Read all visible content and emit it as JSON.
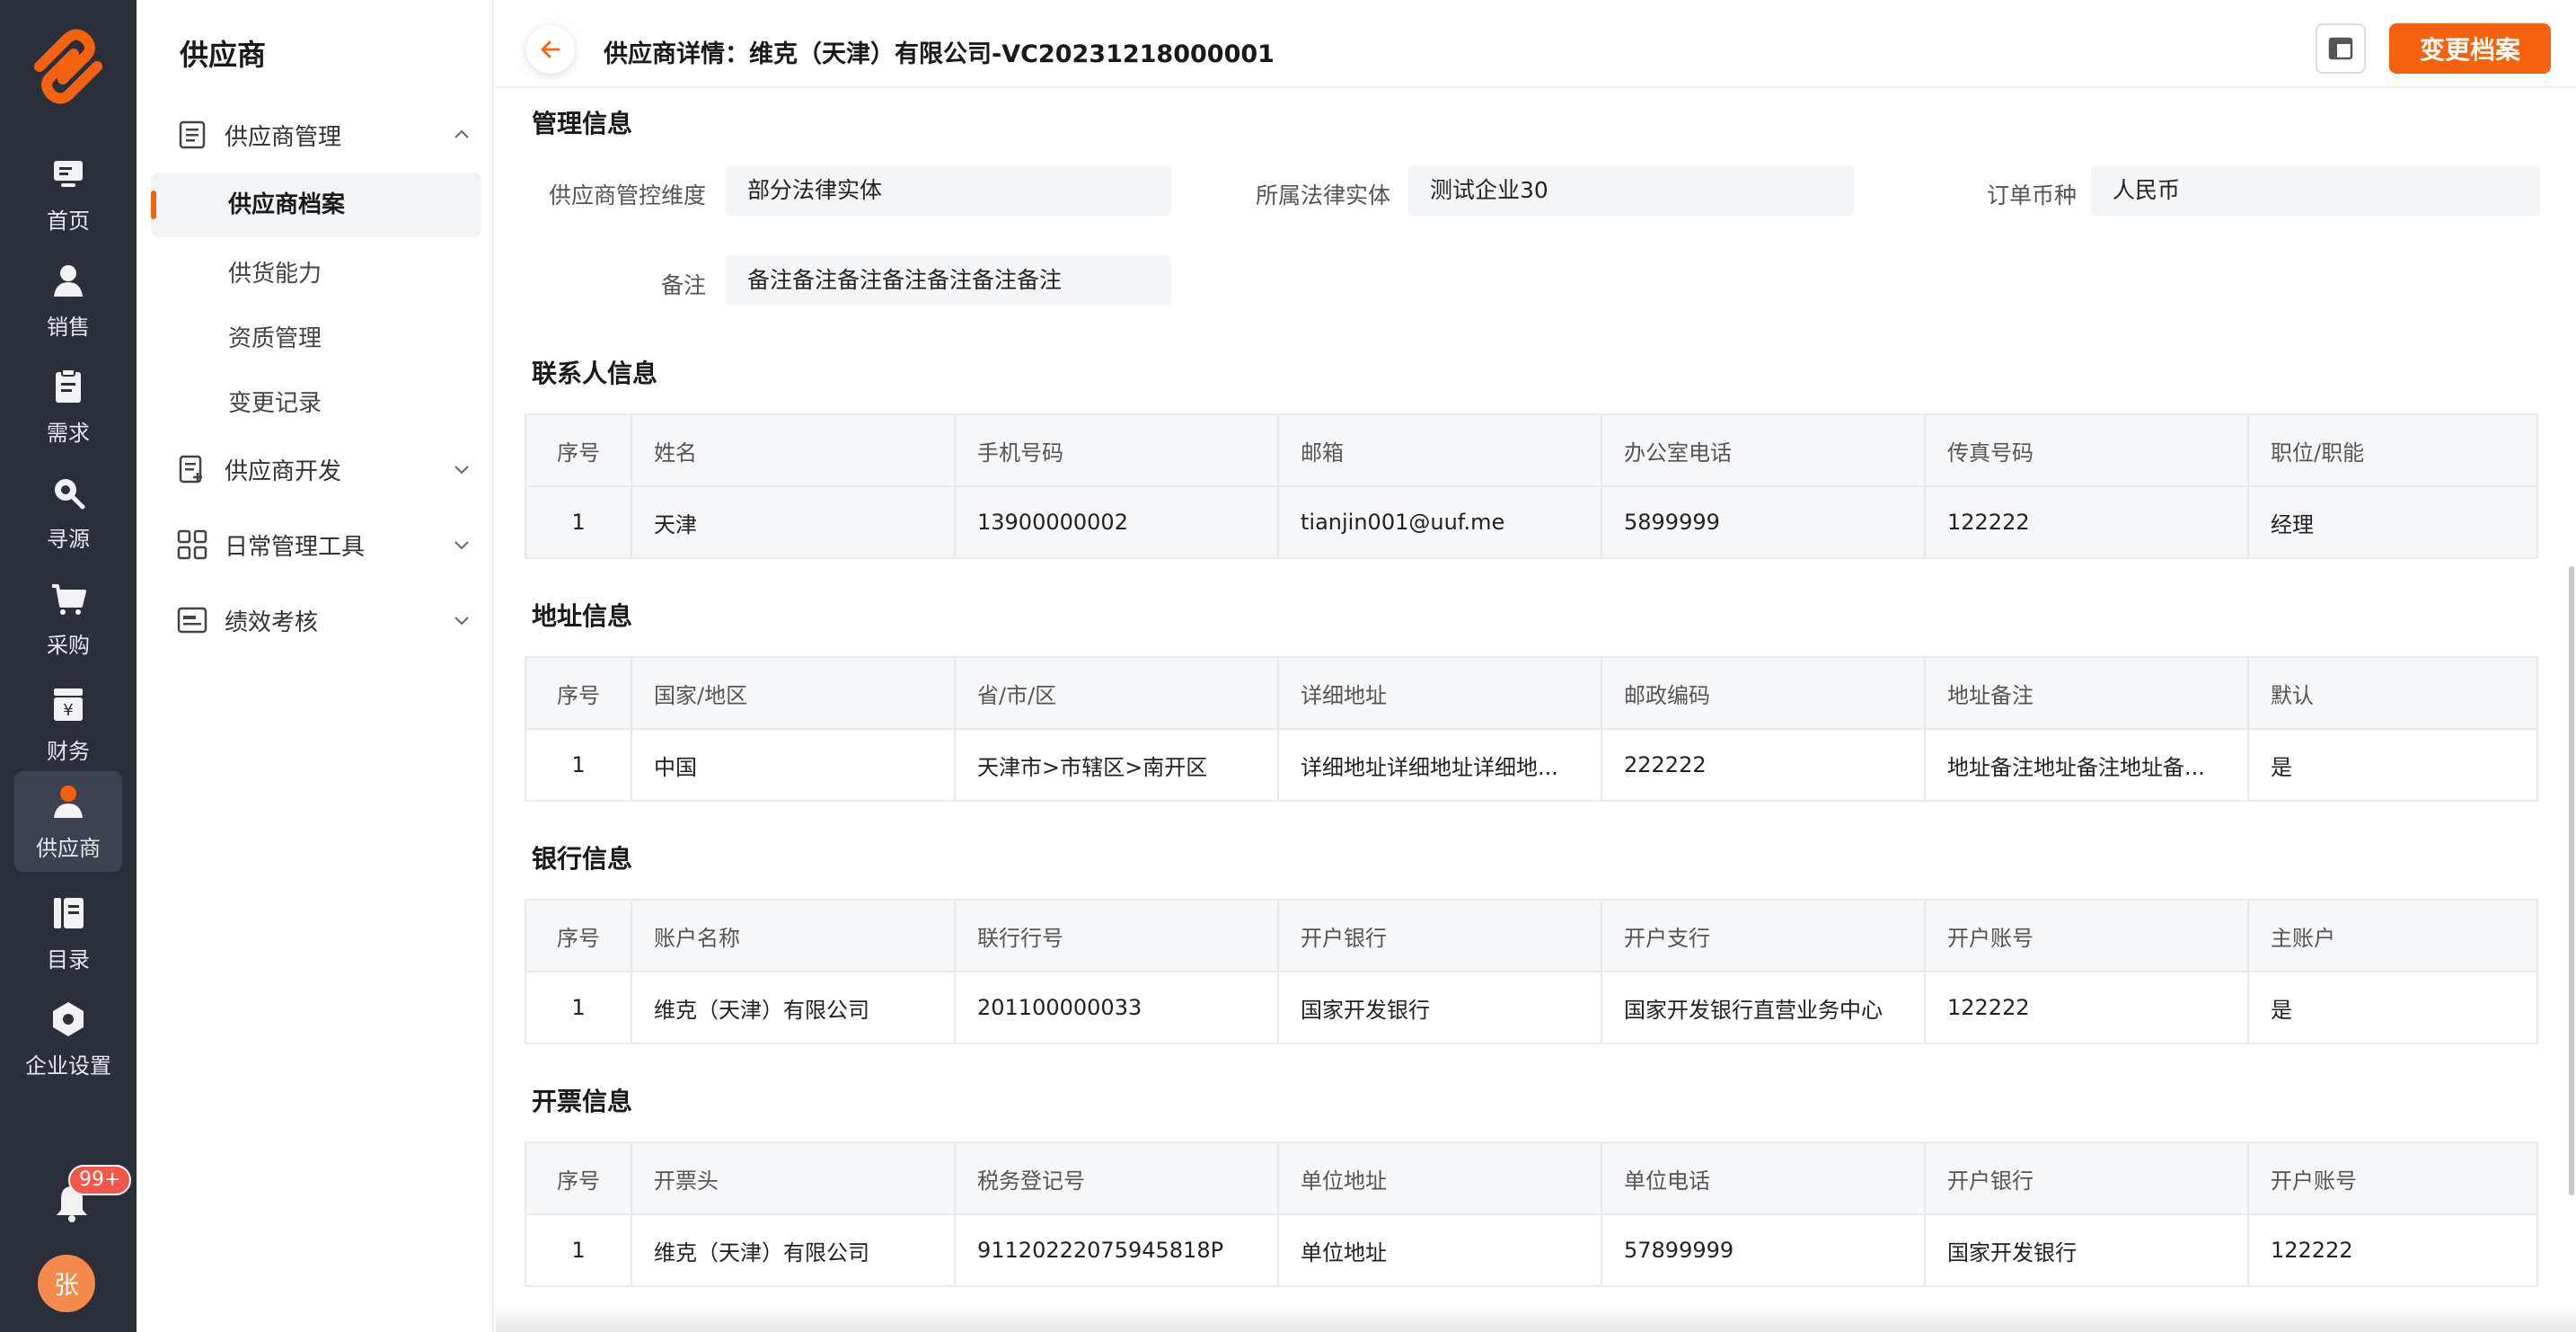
{
  "rail": {
    "items": [
      {
        "label": "首页",
        "icon": "monitor-icon"
      },
      {
        "label": "销售",
        "icon": "user-icon"
      },
      {
        "label": "需求",
        "icon": "clipboard-icon"
      },
      {
        "label": "寻源",
        "icon": "search-icon"
      },
      {
        "label": "采购",
        "icon": "cart-icon"
      },
      {
        "label": "财务",
        "icon": "yen-icon"
      },
      {
        "label": "供应商",
        "icon": "supplier-icon",
        "active": true
      },
      {
        "label": "目录",
        "icon": "catalog-icon"
      },
      {
        "label": "企业设置",
        "icon": "hexagon-icon"
      }
    ],
    "notification_badge": "99+",
    "avatar_text": "张"
  },
  "subnav": {
    "title": "供应商",
    "groups": [
      {
        "label": "供应商管理",
        "icon": "list-icon",
        "expanded": true
      },
      {
        "label": "供应商开发",
        "icon": "edit-list-icon",
        "expanded": false
      },
      {
        "label": "日常管理工具",
        "icon": "grid-icon",
        "expanded": false
      },
      {
        "label": "绩效考核",
        "icon": "card-icon",
        "expanded": false
      }
    ],
    "sub_items": [
      {
        "label": "供应商档案",
        "active": true
      },
      {
        "label": "供货能力"
      },
      {
        "label": "资质管理"
      },
      {
        "label": "变更记录"
      }
    ]
  },
  "header": {
    "title": "供应商详情：维克（天津）有限公司-VC20231218000001",
    "change_button": "变更档案"
  },
  "management": {
    "title": "管理信息",
    "fields": [
      {
        "label": "供应商管控维度",
        "value": "部分法律实体"
      },
      {
        "label": "所属法律实体",
        "value": "测试企业30"
      },
      {
        "label": "订单币种",
        "value": "人民币"
      },
      {
        "label": "备注",
        "value": "备注备注备注备注备注备注备注"
      }
    ]
  },
  "contacts": {
    "title": "联系人信息",
    "columns": [
      "序号",
      "姓名",
      "手机号码",
      "邮箱",
      "办公室电话",
      "传真号码",
      "职位/职能"
    ],
    "rows": [
      [
        "1",
        "天津",
        "13900000002",
        "tianjin001@uuf.me",
        "5899999",
        "122222",
        "经理"
      ]
    ]
  },
  "address": {
    "title": "地址信息",
    "columns": [
      "序号",
      "国家/地区",
      "省/市/区",
      "详细地址",
      "邮政编码",
      "地址备注",
      "默认"
    ],
    "rows": [
      [
        "1",
        "中国",
        "天津市>市辖区>南开区",
        "详细地址详细地址详细地...",
        "222222",
        "地址备注地址备注地址备...",
        "是"
      ]
    ]
  },
  "bank": {
    "title": "银行信息",
    "columns": [
      "序号",
      "账户名称",
      "联行行号",
      "开户银行",
      "开户支行",
      "开户账号",
      "主账户"
    ],
    "rows": [
      [
        "1",
        "维克（天津）有限公司",
        "201100000033",
        "国家开发银行",
        "国家开发银行直营业务中心",
        "122222",
        "是"
      ]
    ]
  },
  "invoice": {
    "title": "开票信息",
    "columns": [
      "序号",
      "开票头",
      "税务登记号",
      "单位地址",
      "单位电话",
      "开户银行",
      "开户账号"
    ],
    "rows": [
      [
        "1",
        "维克（天津）有限公司",
        "91120222075945818P",
        "单位地址",
        "57899999",
        "国家开发银行",
        "122222"
      ]
    ]
  },
  "colors": {
    "accent": "#f5620e",
    "rail_bg": "#2b2f3a",
    "badge": "#f5564a"
  }
}
